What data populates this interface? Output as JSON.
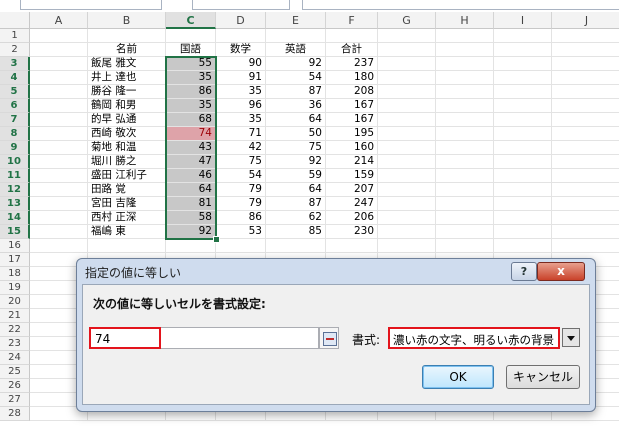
{
  "columns": [
    "A",
    "B",
    "C",
    "D",
    "E",
    "F",
    "G",
    "H",
    "I",
    "J"
  ],
  "rows": [
    "1",
    "2",
    "3",
    "4",
    "5",
    "6",
    "7",
    "8",
    "9",
    "10",
    "11",
    "12",
    "13",
    "14",
    "15",
    "16",
    "17",
    "18",
    "19",
    "20",
    "21",
    "22",
    "23",
    "24",
    "25",
    "26",
    "27",
    "28"
  ],
  "table": {
    "headers": [
      "名前",
      "国語",
      "数学",
      "英語",
      "合計"
    ],
    "data": [
      [
        "飯尾 雅文",
        "55",
        "90",
        "92",
        "237"
      ],
      [
        "井上 達也",
        "35",
        "91",
        "54",
        "180"
      ],
      [
        "勝谷 隆一",
        "86",
        "35",
        "87",
        "208"
      ],
      [
        "鶴岡 和男",
        "35",
        "96",
        "36",
        "167"
      ],
      [
        "的早 弘通",
        "68",
        "35",
        "64",
        "167"
      ],
      [
        "西崎 敬次",
        "74",
        "71",
        "50",
        "195"
      ],
      [
        "菊地 和温",
        "43",
        "42",
        "75",
        "160"
      ],
      [
        "堀川 勝之",
        "47",
        "75",
        "92",
        "214"
      ],
      [
        "盛田 江利子",
        "46",
        "54",
        "59",
        "159"
      ],
      [
        "田路 覚",
        "64",
        "79",
        "64",
        "207"
      ],
      [
        "宮田 吉隆",
        "81",
        "79",
        "87",
        "247"
      ],
      [
        "西村 正深",
        "58",
        "86",
        "62",
        "206"
      ],
      [
        "福嶋 東",
        "92",
        "53",
        "85",
        "230"
      ]
    ]
  },
  "dialog": {
    "title": "指定の値に等しい",
    "help": "?",
    "close": "x",
    "prompt": "次の値に等しいセルを書式設定:",
    "value": "74",
    "format_label": "書式:",
    "format_value": "濃い赤の文字、明るい赤の背景",
    "ok": "OK",
    "cancel": "キャンセル"
  },
  "colors": {
    "selection": "#217346",
    "highlight_bg": "#dea3a9",
    "highlight_text": "#9c0006",
    "annotation": "#e3141c"
  }
}
